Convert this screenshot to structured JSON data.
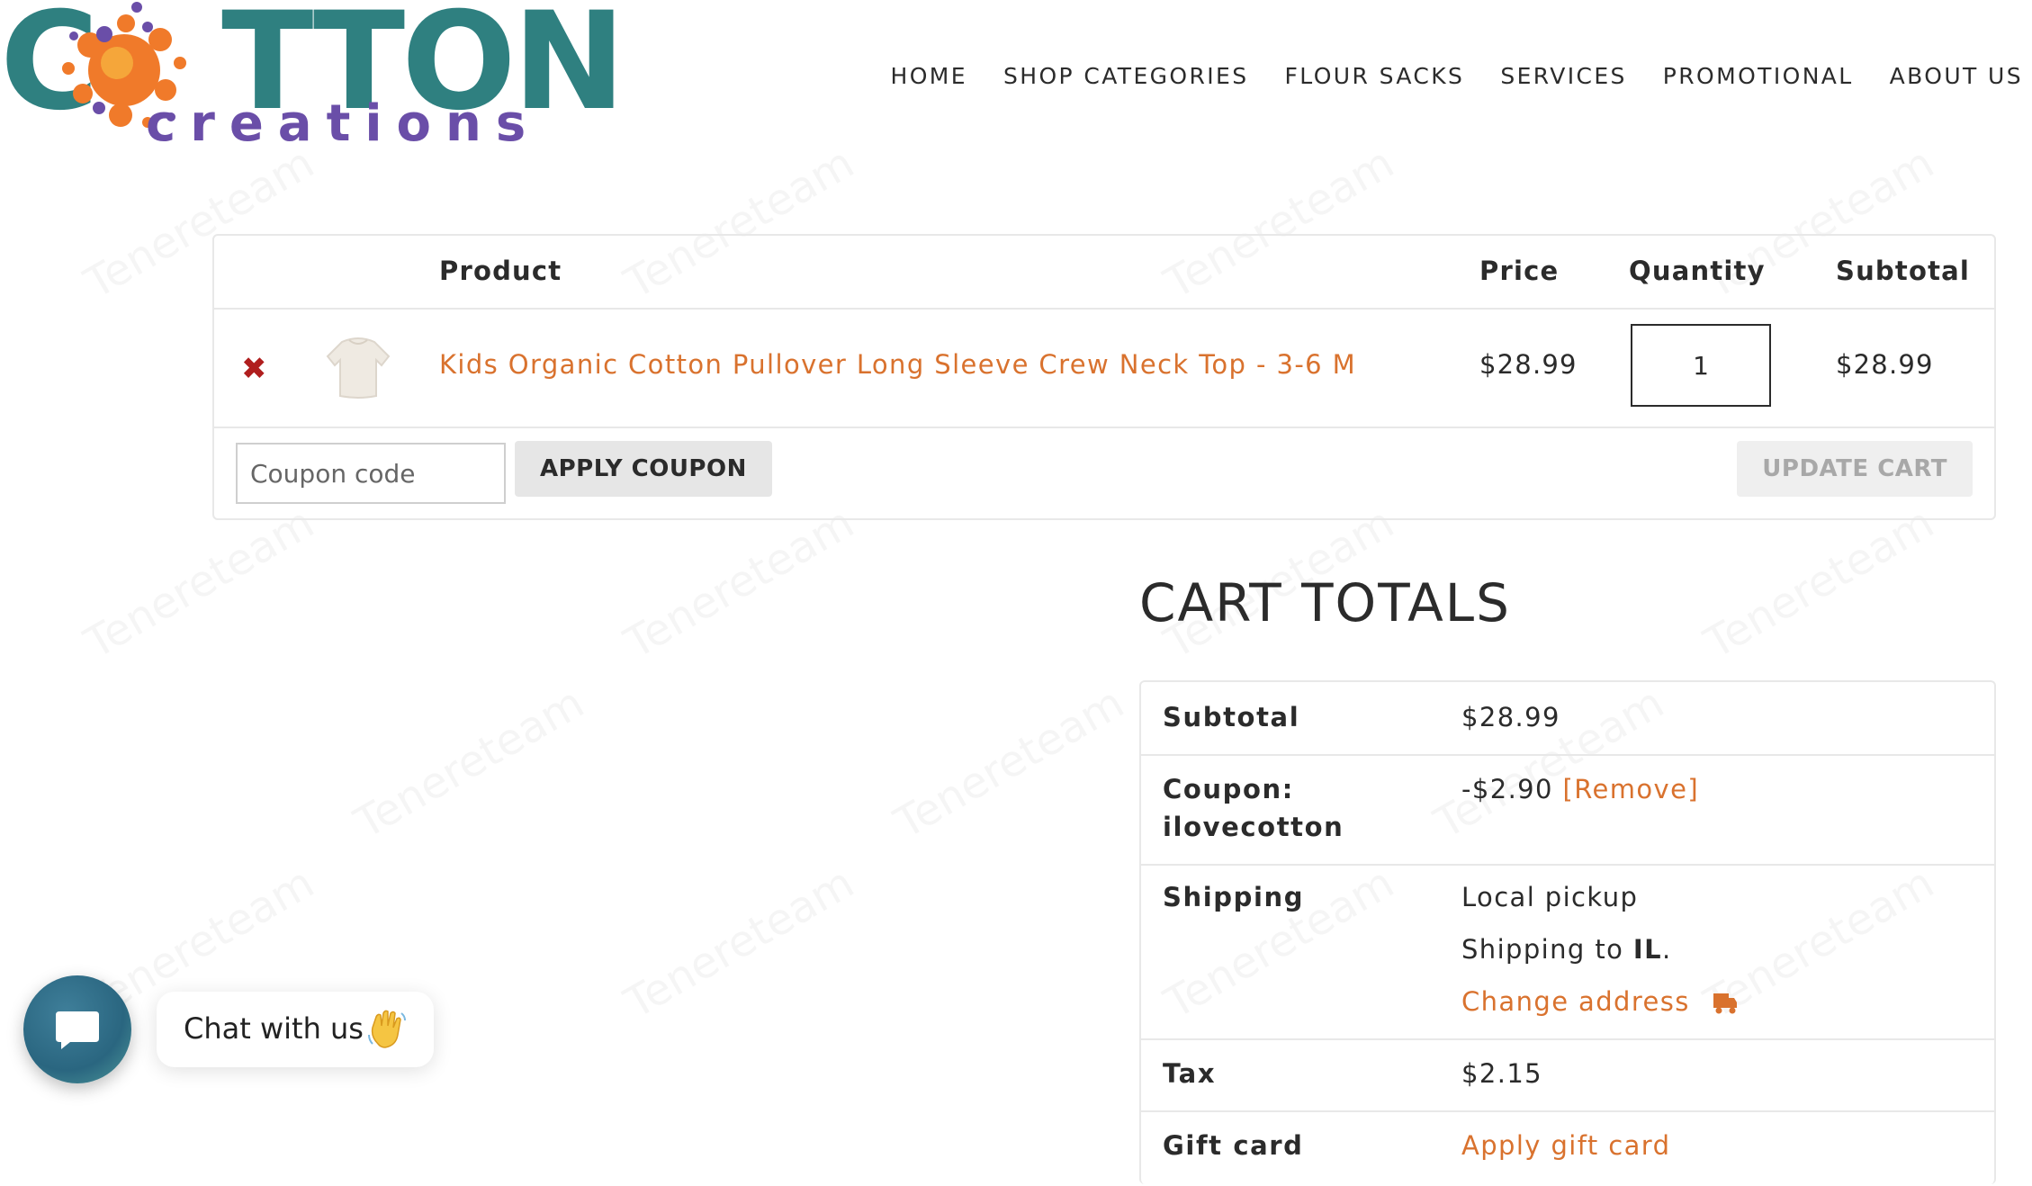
{
  "brand": {
    "logo_word_left": "C",
    "logo_word_right": "TTON",
    "logo_sub": "creations"
  },
  "nav": [
    "HOME",
    "SHOP CATEGORIES",
    "FLOUR SACKS",
    "SERVICES",
    "PROMOTIONAL",
    "ABOUT US"
  ],
  "cart": {
    "headers": {
      "product": "Product",
      "price": "Price",
      "quantity": "Quantity",
      "subtotal": "Subtotal"
    },
    "items": [
      {
        "remove_symbol": "✖",
        "name": "Kids Organic Cotton Pullover Long Sleeve Crew Neck Top - 3-6 M",
        "price": "$28.99",
        "quantity": "1",
        "subtotal": "$28.99"
      }
    ],
    "coupon_placeholder": "Coupon code",
    "apply_coupon_label": "APPLY COUPON",
    "update_cart_label": "UPDATE CART"
  },
  "totals": {
    "title": "CART TOTALS",
    "subtotal_label": "Subtotal",
    "subtotal_value": "$28.99",
    "coupon_label_1": "Coupon:",
    "coupon_label_2": "ilovecotton",
    "coupon_value": "-$2.90",
    "coupon_remove": "[Remove]",
    "shipping_label": "Shipping",
    "shipping_method": "Local pickup",
    "shipping_to_prefix": "Shipping to",
    "shipping_to_state": "IL",
    "shipping_to_suffix": ".",
    "change_address": "Change address",
    "tax_label": "Tax",
    "tax_value": "$2.15",
    "gift_label": "Gift card",
    "gift_value": "Apply gift card"
  },
  "chat": {
    "label": "Chat with us"
  },
  "watermark": "Tenereteam",
  "colors": {
    "teal": "#2f8080",
    "purple": "#6a4ea8",
    "orange": "#d9722e",
    "remove_red": "#b01e1e"
  },
  "icons": [
    "splash-logo-icon",
    "remove-icon",
    "shirt-thumbnail",
    "truck-icon",
    "chat-icon",
    "waving-hand-icon"
  ]
}
